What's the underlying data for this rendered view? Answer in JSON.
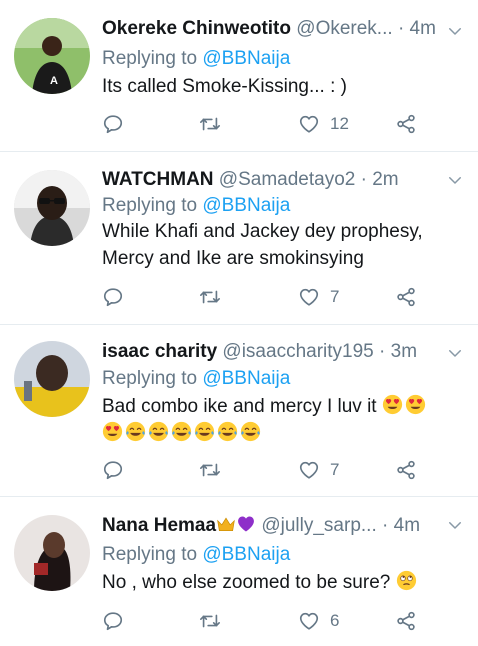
{
  "tweets": [
    {
      "name": "Okereke Chinweotito",
      "handle": "@Okerek...",
      "time": "4m",
      "reply_prefix": "Replying to",
      "reply_to": "@BBNaija",
      "text": "Its called Smoke-Kissing... : )",
      "likes": "12",
      "emoji_after": []
    },
    {
      "name": "WATCHMAN",
      "handle": "@Samadetayo2",
      "time": "2m",
      "reply_prefix": "Replying to",
      "reply_to": "@BBNaija",
      "text": "While Khafi and Jackey dey prophesy, Mercy and Ike are smokinsying",
      "likes": "7",
      "emoji_after": []
    },
    {
      "name": "isaac charity",
      "handle": "@isaaccharity195",
      "time": "3m",
      "reply_prefix": "Replying to",
      "reply_to": "@BBNaija",
      "text": "Bad combo ike and mercy I luv it",
      "likes": "7",
      "emoji_after": [
        "heart-eyes-emoji",
        "heart-eyes-emoji"
      ],
      "emoji_line2": [
        "heart-eyes-emoji",
        "tears-of-joy-emoji",
        "tears-of-joy-emoji",
        "tears-of-joy-emoji",
        "tears-of-joy-emoji",
        "tears-of-joy-emoji",
        "tears-of-joy-emoji"
      ]
    },
    {
      "name": "Nana Hemaa",
      "handle": "@jully_sarp...",
      "time": "4m",
      "reply_prefix": "Replying to",
      "reply_to": "@BBNaija",
      "text": "No , who else zoomed to be sure?",
      "likes": "6",
      "emoji_after": [
        "rolling-eyes-emoji"
      ]
    }
  ],
  "separator": "·",
  "colors": {
    "accent": "#1da1f2",
    "muted": "#657786",
    "text": "#14171a",
    "divider": "#e6ecf0"
  },
  "icons": [
    "reply-icon",
    "retweet-icon",
    "like-icon",
    "share-icon",
    "chevron-down-icon"
  ]
}
